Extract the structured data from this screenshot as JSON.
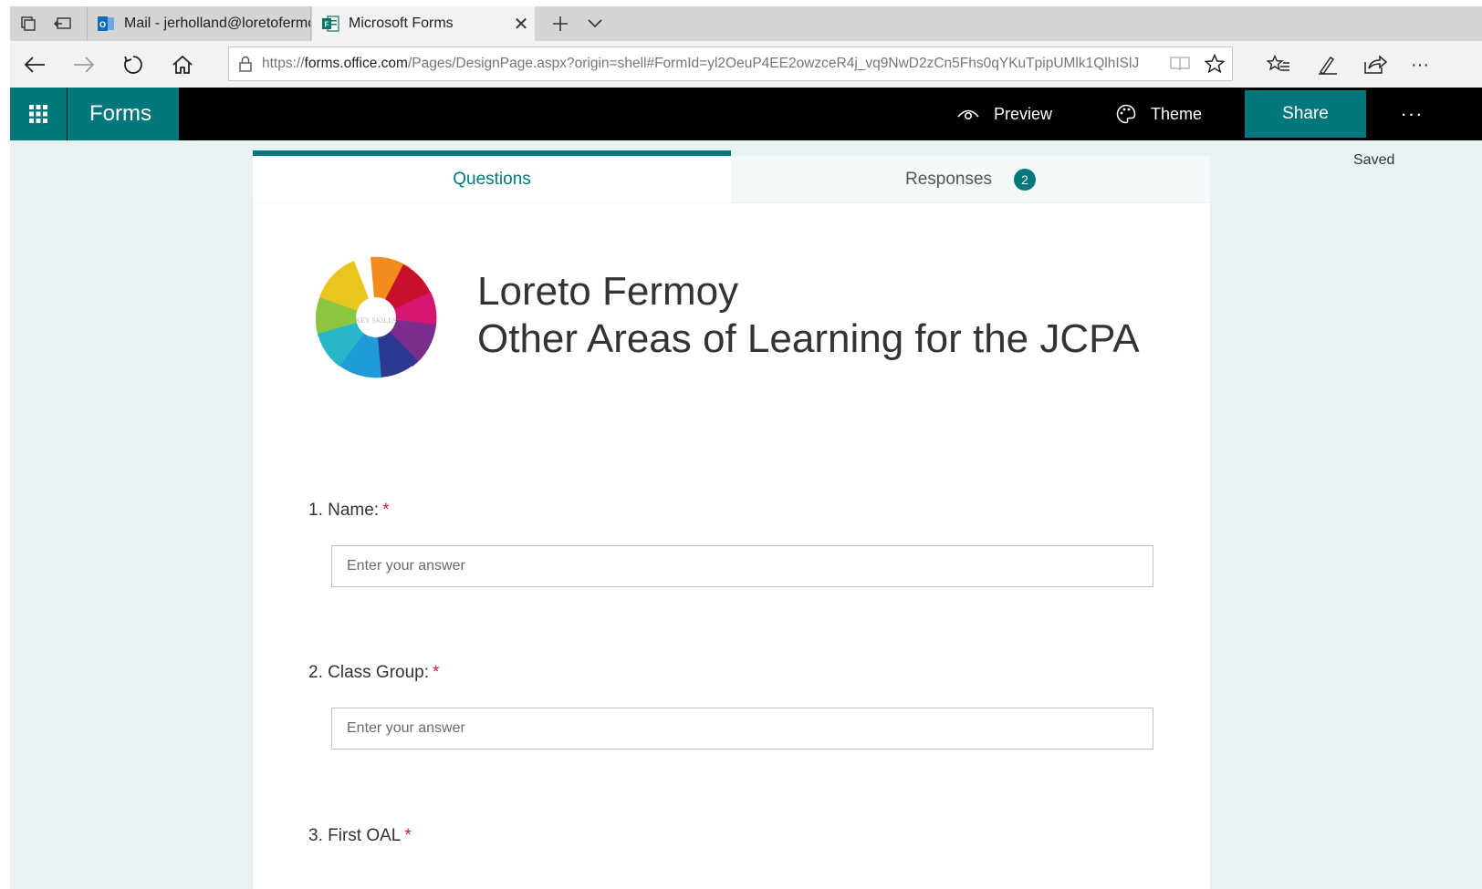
{
  "browser": {
    "tabs": [
      {
        "title": "Mail - jerholland@loretofermoy",
        "icon": "outlook-icon",
        "active": false
      },
      {
        "title": "Microsoft Forms",
        "icon": "forms-icon",
        "active": true
      }
    ],
    "url_prefix": "https://",
    "url_host": "forms.office.com",
    "url_path": "/Pages/DesignPage.aspx?origin=shell#FormId=yl2OeuP4EE2owzceR4j_vq9NwD2zCn5Fhs0qYKuTpipUMlk1QlhISlJ"
  },
  "app": {
    "name": "Forms",
    "preview_label": "Preview",
    "theme_label": "Theme",
    "share_label": "Share",
    "more_label": "···",
    "status": "Saved",
    "accent_color": "#03787c"
  },
  "tabs": {
    "questions_label": "Questions",
    "responses_label": "Responses",
    "responses_count": "2"
  },
  "form": {
    "title_line1": "Loreto Fermoy",
    "title_line2": "Other Areas of Learning for the JCPA",
    "logo_center_text": "KEY SKILLS",
    "questions": [
      {
        "label": "1. Name:",
        "required_mark": "*",
        "placeholder": "Enter your answer"
      },
      {
        "label": "2. Class Group:",
        "required_mark": "*",
        "placeholder": "Enter your answer"
      },
      {
        "label": "3. First OAL",
        "required_mark": "*"
      }
    ]
  }
}
